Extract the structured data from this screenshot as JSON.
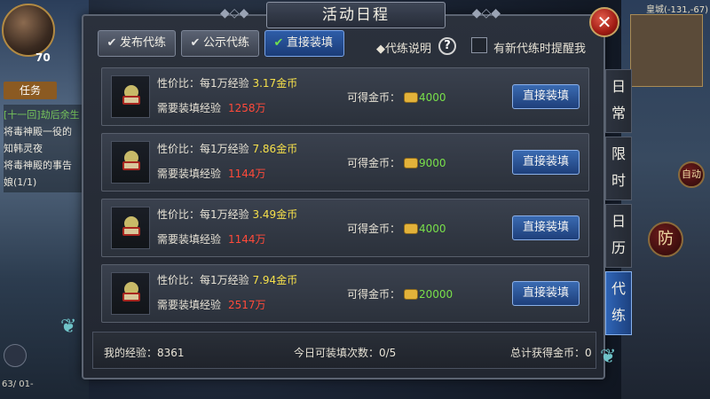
{
  "hud": {
    "level": "70",
    "quest_tab": "任务",
    "quest_lines": [
      "[十一回]劫后余生",
      "将毒神殿一役的",
      "知韩灵夜",
      "将毒神殿的事告",
      "娘(1/1)"
    ],
    "bottom_left": "63/ 01-",
    "coords": "皇城(-131,-67)",
    "auto_label": "自动",
    "skill_right": "防"
  },
  "panel": {
    "title": "活动日程",
    "tabs": [
      {
        "label": "发布代练",
        "check": "✔"
      },
      {
        "label": "公示代练",
        "check": "✔"
      },
      {
        "label": "直接装填",
        "check": "✔"
      }
    ],
    "explain_label": "◆代练说明",
    "help_symbol": "?",
    "remind_label": "有新代练时提醒我",
    "rows": [
      {
        "ratio_prefix": "性价比：每1万经验",
        "ratio": "3.17金币",
        "need_label": "需要装填经验",
        "need": "1258万",
        "gold_label": "可得金币：",
        "gold": "4000",
        "button": "直接装填"
      },
      {
        "ratio_prefix": "性价比：每1万经验",
        "ratio": "7.86金币",
        "need_label": "需要装填经验",
        "need": "1144万",
        "gold_label": "可得金币：",
        "gold": "9000",
        "button": "直接装填"
      },
      {
        "ratio_prefix": "性价比：每1万经验",
        "ratio": "3.49金币",
        "need_label": "需要装填经验",
        "need": "1144万",
        "gold_label": "可得金币：",
        "gold": "4000",
        "button": "直接装填"
      },
      {
        "ratio_prefix": "性价比：每1万经验",
        "ratio": "7.94金币",
        "need_label": "需要装填经验",
        "need": "2517万",
        "gold_label": "可得金币：",
        "gold": "20000",
        "button": "直接装填"
      }
    ],
    "footer": {
      "my_exp": "我的经验：8361",
      "today_fills": "今日可装填次数：0/5",
      "total_gold": "总计获得金币：0"
    },
    "side_tabs": [
      {
        "chars": [
          "日",
          "常"
        ]
      },
      {
        "chars": [
          "限",
          "时"
        ]
      },
      {
        "chars": [
          "日",
          "历"
        ]
      },
      {
        "chars": [
          "代",
          "练"
        ]
      }
    ]
  },
  "colors": {
    "accent_blue": "#2e5da8",
    "highlight_yellow": "#f6e04a",
    "required_red": "#ff4a3a",
    "gold_green": "#79e04a"
  }
}
